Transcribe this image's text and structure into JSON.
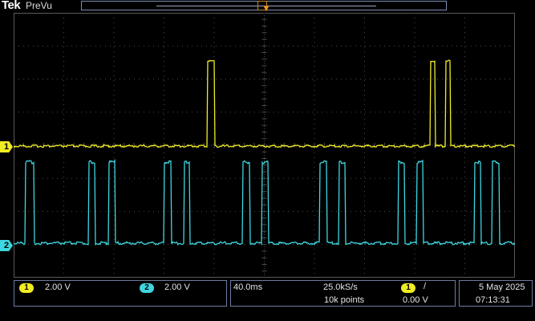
{
  "header": {
    "brand": "Tek",
    "mode": "PreVu"
  },
  "channels": [
    {
      "id": "1",
      "scale": "2.00 V",
      "color": "#f0ec24"
    },
    {
      "id": "2",
      "scale": "2.00 V",
      "color": "#3ed6e0"
    }
  ],
  "timebase": {
    "scale": "40.0ms",
    "sample_rate": "25.0kS/s",
    "record_length": "10k points"
  },
  "trigger": {
    "source": "1",
    "slope_symbol": "/",
    "level": "0.00 V",
    "marker_color": "#f0922a"
  },
  "datetime": {
    "date": "5 May 2025",
    "time": "07:13:31"
  },
  "colors": {
    "grid": "#5a5a5a",
    "panel_border": "#6d7da0"
  }
}
